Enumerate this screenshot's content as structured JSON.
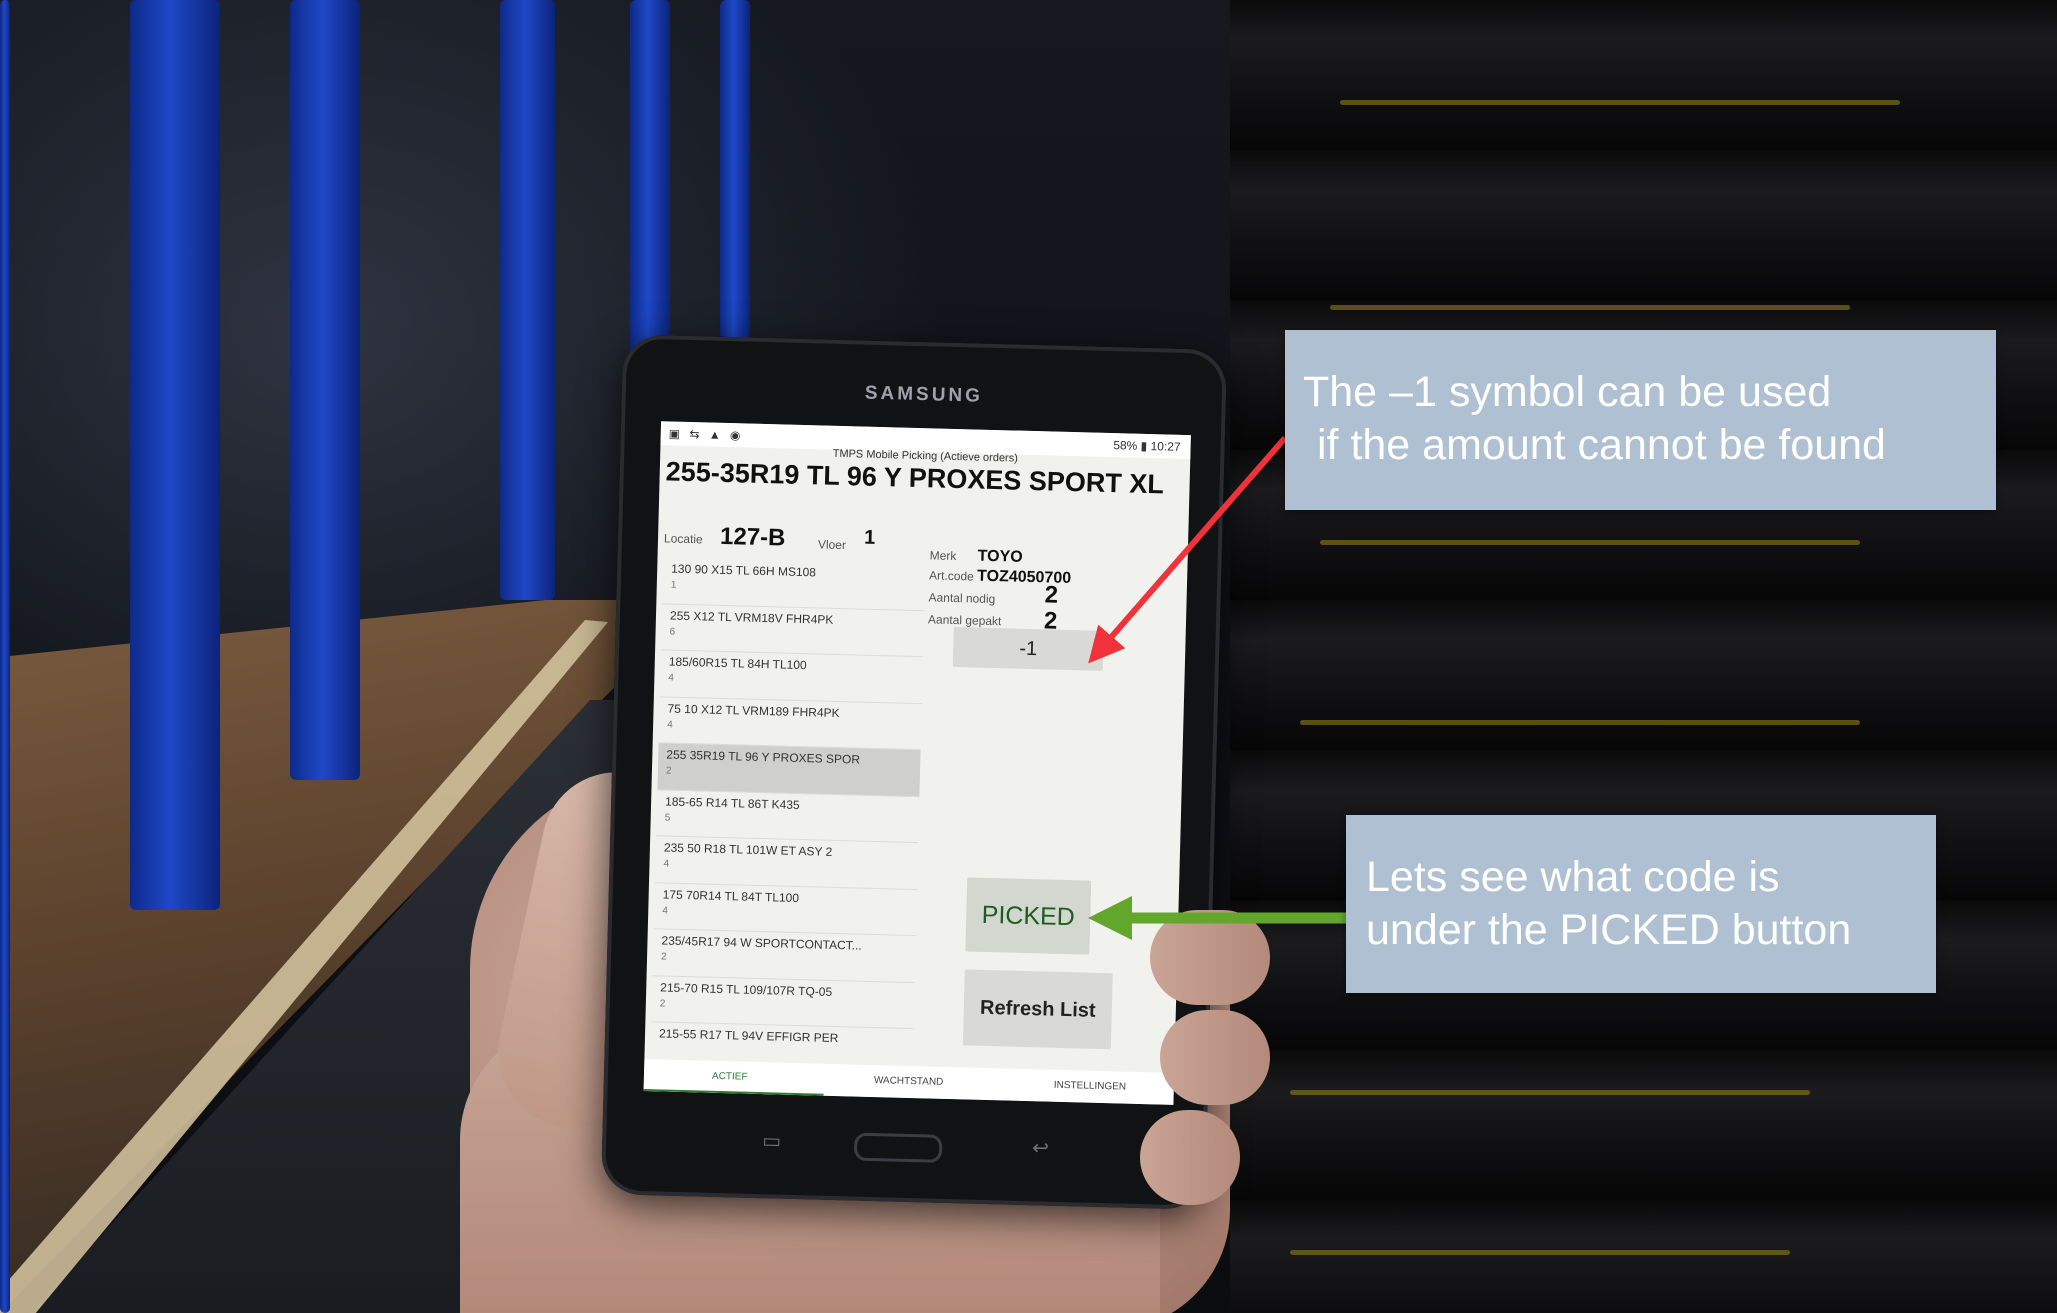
{
  "phone": {
    "brand": "SAMSUNG",
    "status": {
      "icons": "▣ ⇆ ▲ ◉",
      "right": "58% ▮ 10:27"
    },
    "app_title": "TMPS Mobile Picking (Actieve orders)",
    "product_title": "255-35R19 TL 96 Y PROXES SPORT XL",
    "location_label": "Locatie",
    "location_value": "127-B",
    "floor_label": "Vloer",
    "floor_value": "1",
    "brand_label": "Merk",
    "brand_value": "TOYO",
    "article_label": "Art.code",
    "article_value": "TOZ4050700",
    "qty_needed_label": "Aantal nodig",
    "qty_needed_value": "2",
    "qty_picked_label": "Aantal gepakt",
    "qty_picked_value": "2",
    "minus_button": "-1",
    "picked_button": "PICKED",
    "refresh_button": "Refresh List",
    "list": [
      {
        "title": "130 90 X15 TL 66H MS108",
        "sub": "1"
      },
      {
        "title": "255 X12 TL VRM18V FHR4PK",
        "sub": "6"
      },
      {
        "title": "185/60R15 TL 84H TL100",
        "sub": "4"
      },
      {
        "title": "75 10 X12 TL VRM189 FHR4PK",
        "sub": "4"
      },
      {
        "title": "255 35R19 TL 96 Y PROXES SPOR",
        "sub": "2"
      },
      {
        "title": "185-65 R14 TL 86T K435",
        "sub": "5"
      },
      {
        "title": "235 50 R18 TL 101W ET ASY 2",
        "sub": "4"
      },
      {
        "title": "175 70R14 TL 84T TL100",
        "sub": "4"
      },
      {
        "title": "235/45R17 94 W SPORTCONTACT...",
        "sub": "2"
      },
      {
        "title": "215-70 R15 TL 109/107R TQ-05",
        "sub": "2"
      },
      {
        "title": "215-55 R17 TL 94V EFFIGR PER",
        "sub": ""
      }
    ],
    "tabs": [
      "Actief",
      "Wachtstand",
      "Instellingen"
    ]
  },
  "callouts": {
    "first": [
      "The –1 symbol can be used",
      "if the amount cannot be found"
    ],
    "second": [
      "Lets see what code is",
      "under the PICKED button"
    ]
  },
  "colors": {
    "callout_bg": "#aec0d1",
    "red_arrow": "#f0323a",
    "green_arrow": "#62a72c"
  }
}
